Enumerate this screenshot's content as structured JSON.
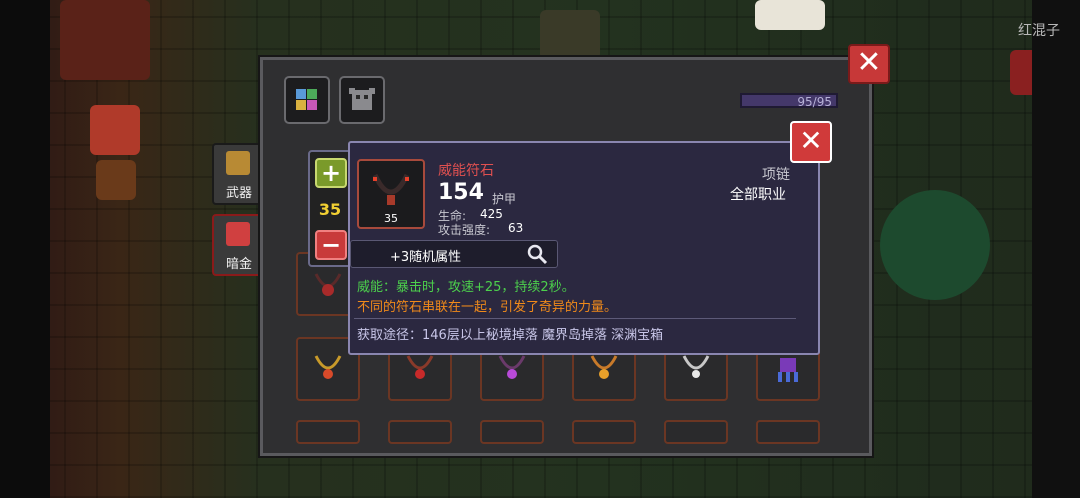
{
  "player_name": "红混子",
  "side_tabs": [
    {
      "label": "武器",
      "color": "#b88a34"
    },
    {
      "label": "暗金",
      "color": "#d04040"
    }
  ],
  "panel": {
    "hp_text": "95/95",
    "tabs": [
      {
        "icon": "palette-icon"
      },
      {
        "icon": "armor-icon"
      }
    ]
  },
  "quantity": {
    "plus": "+",
    "value": "35",
    "minus": "−"
  },
  "item": {
    "name": "威能符石",
    "icon_count": "35",
    "main_value": "154",
    "main_stat": "护甲",
    "slot": "项链",
    "class": "全部职业",
    "stats": [
      {
        "label": "生命:",
        "value": "425"
      },
      {
        "label": "攻击强度:",
        "value": "63"
      }
    ],
    "random_attrs": "+3随机属性",
    "effect": "威能：暴击时，攻速+25，持续2秒。",
    "flavor": "不同的符石串联在一起，引发了奇异的力量。",
    "source": "获取途径：146层以上秘境掉落 魔界岛掉落 深渊宝箱"
  },
  "colors": {
    "name": "#e05050",
    "effect": "#4cd04c",
    "flavor": "#f08a1a",
    "source": "#c8c6e8",
    "text": "#ffffff",
    "muted": "#c8c8d0"
  },
  "close_glyph": "✕"
}
